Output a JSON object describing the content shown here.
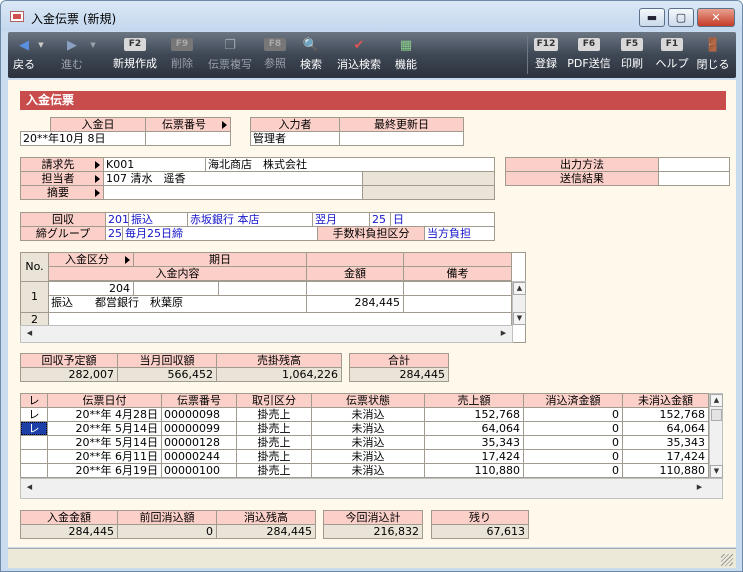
{
  "window": {
    "title": "入金伝票 (新規)",
    "min": "▬",
    "max": "▢",
    "close": "✕"
  },
  "toolbar": {
    "back": "戻る",
    "forward": "進む",
    "new": "新規作成",
    "new_key": "F2",
    "delete": "削除",
    "delete_key": "F9",
    "copy": "伝票複写",
    "copy_key": "",
    "ref": "参照",
    "ref_key": "F8",
    "search": "検索",
    "clear_search": "消込検索",
    "func": "機能",
    "register": "登録",
    "register_key": "F12",
    "pdf": "PDF送信",
    "pdf_key": "F6",
    "print": "印刷",
    "print_key": "F5",
    "help": "ヘルプ",
    "help_key": "F1",
    "close": "閉じる"
  },
  "header": {
    "title": "入金伝票"
  },
  "fields": {
    "date_label": "入金日",
    "date_value": "20**年10月 8日",
    "slip_no_label": "伝票番号",
    "slip_no_value": "",
    "entered_by_label": "入力者",
    "entered_by_value": "管理者",
    "last_updated_label": "最終更新日",
    "last_updated_value": "",
    "bill_to_label": "請求先",
    "bill_to_code": "K001",
    "bill_to_name": "海北商店　株式会社",
    "person_label": "担当者",
    "person_code": "107",
    "person_name": "清水　遥香",
    "summary_label": "摘要",
    "summary_value": "",
    "output_method_label": "出力方法",
    "output_method_value": "",
    "send_result_label": "送信結果",
    "send_result_value": "",
    "collection_label": "回収",
    "collection_code": "201",
    "collection_method": "振込",
    "collection_bank": "赤坂銀行 本店",
    "collection_month": "翌月",
    "collection_day_code": "25",
    "collection_day": "日",
    "closing_group_label": "締グループ",
    "closing_group_code": "25",
    "closing_group_value": "毎月25日締",
    "fee_label": "手数料負担区分",
    "fee_value": "当方負担"
  },
  "detail_grid": {
    "no_header": "No.",
    "type_header": "入金区分",
    "due_header": "期日",
    "content_header": "入金内容",
    "amount_header": "金額",
    "note_header": "備考",
    "rows": [
      {
        "no": "1",
        "code": "204",
        "type": "振込",
        "content": "都営銀行　秋葉原",
        "amount": "284,445"
      },
      {
        "no": "2"
      }
    ]
  },
  "summary1": {
    "planned_label": "回収予定額",
    "planned_value": "282,007",
    "month_label": "当月回収額",
    "month_value": "566,452",
    "ar_label": "売掛残高",
    "ar_value": "1,064,226",
    "total_label": "合計",
    "total_value": "284,445"
  },
  "invoice_grid": {
    "headers": [
      "レ",
      "伝票日付",
      "伝票番号",
      "取引区分",
      "伝票状態",
      "売上額",
      "消込済金額",
      "未消込金額"
    ],
    "rows": [
      [
        "レ",
        "20**年 4月28日",
        "00000098",
        "掛売上",
        "未消込",
        "152,768",
        "0",
        "152,768"
      ],
      [
        "レ",
        "20**年 5月14日",
        "00000099",
        "掛売上",
        "未消込",
        "64,064",
        "0",
        "64,064"
      ],
      [
        "",
        "20**年 5月14日",
        "00000128",
        "掛売上",
        "未消込",
        "35,343",
        "0",
        "35,343"
      ],
      [
        "",
        "20**年 6月11日",
        "00000244",
        "掛売上",
        "未消込",
        "17,424",
        "0",
        "17,424"
      ],
      [
        "",
        "20**年 6月19日",
        "00000100",
        "掛売上",
        "未消込",
        "110,880",
        "0",
        "110,880"
      ]
    ]
  },
  "summary2": {
    "deposit_label": "入金金額",
    "deposit_value": "284,445",
    "prev_label": "前回消込額",
    "prev_value": "0",
    "remain_label": "消込残高",
    "remain_value": "284,445",
    "current_label": "今回消込計",
    "current_value": "216,832",
    "rest_label": "残り",
    "rest_value": "67,613"
  }
}
